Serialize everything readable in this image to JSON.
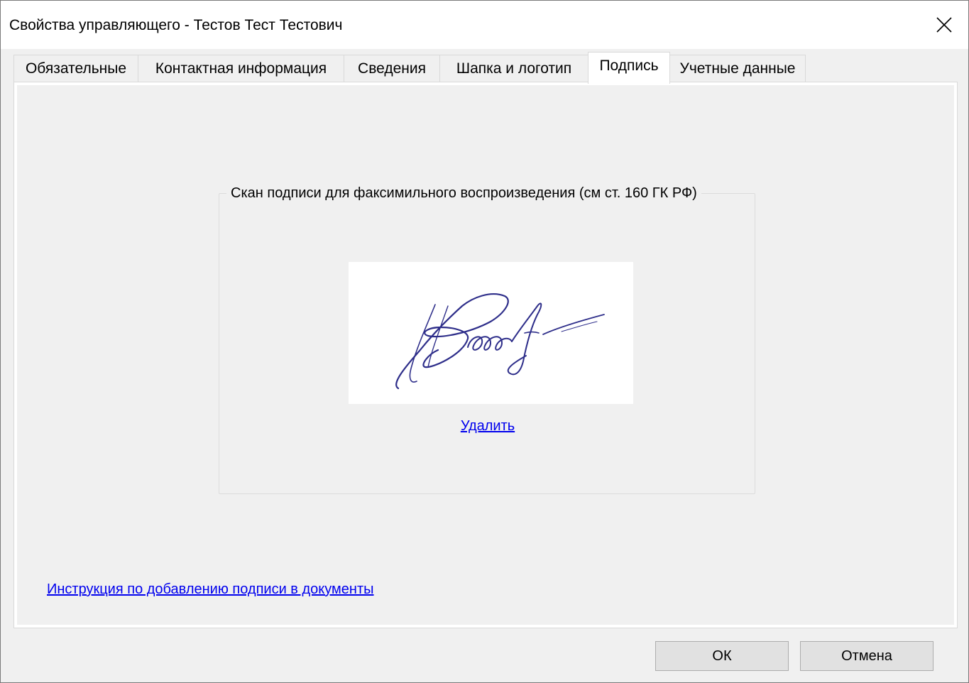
{
  "window": {
    "title": "Свойства управляющего - Тестов Тест Тестович"
  },
  "tabs": [
    {
      "label": "Обязательные",
      "active": false
    },
    {
      "label": "Контактная информация",
      "active": false
    },
    {
      "label": "Сведения",
      "active": false
    },
    {
      "label": "Шапка и логотип",
      "active": false
    },
    {
      "label": "Подпись",
      "active": true
    },
    {
      "label": "Учетные данные",
      "active": false
    }
  ],
  "signature_group": {
    "legend": "Скан подписи для факсимильного воспроизведения (см ст. 160 ГК РФ)",
    "delete_link": "Удалить"
  },
  "instructions_link": "Инструкция по добавлению подписи в документы",
  "buttons": {
    "ok": "ОК",
    "cancel": "Отмена"
  },
  "colors": {
    "link": "#0000ee",
    "signature_ink": "#2e2e8a"
  }
}
